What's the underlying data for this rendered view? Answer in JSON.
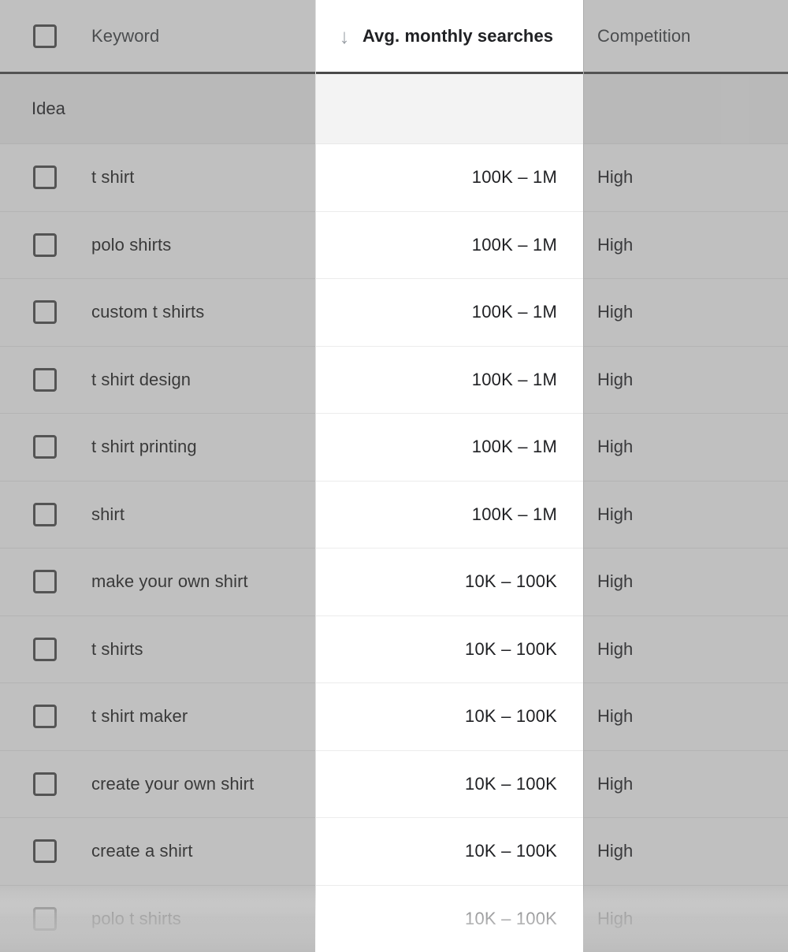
{
  "table": {
    "header": {
      "select_all_checkbox": "select-all",
      "columns": [
        {
          "key": "keyword",
          "label": "Keyword",
          "sorted": false,
          "align": "left"
        },
        {
          "key": "searches",
          "label": "Avg. monthly searches",
          "sorted": true,
          "align": "left",
          "sort_icon": "arrow-down-icon",
          "sort_glyph": "↓",
          "sort_direction": "descending"
        },
        {
          "key": "competition",
          "label": "Competition",
          "sorted": false,
          "align": "left"
        }
      ]
    },
    "group_row": {
      "label": "Idea"
    },
    "rows": [
      {
        "keyword": "t shirt",
        "searches": "100K – 1M",
        "competition": "High"
      },
      {
        "keyword": "polo shirts",
        "searches": "100K – 1M",
        "competition": "High"
      },
      {
        "keyword": "custom t shirts",
        "searches": "100K – 1M",
        "competition": "High"
      },
      {
        "keyword": "t shirt design",
        "searches": "100K – 1M",
        "competition": "High"
      },
      {
        "keyword": "t shirt printing",
        "searches": "100K – 1M",
        "competition": "High"
      },
      {
        "keyword": "shirt",
        "searches": "100K – 1M",
        "competition": "High"
      },
      {
        "keyword": "make your own shirt",
        "searches": "10K – 100K",
        "competition": "High"
      },
      {
        "keyword": "t shirts",
        "searches": "10K – 100K",
        "competition": "High"
      },
      {
        "keyword": "t shirt maker",
        "searches": "10K – 100K",
        "competition": "High"
      },
      {
        "keyword": "create your own shirt",
        "searches": "10K – 100K",
        "competition": "High"
      },
      {
        "keyword": "create a shirt",
        "searches": "10K – 100K",
        "competition": "High"
      },
      {
        "keyword": "polo t shirts",
        "searches": "10K – 100K",
        "competition": "High"
      }
    ]
  },
  "colors": {
    "highlight_column_background": "#ffffff",
    "dimmed_overlay": "#616161",
    "header_rule": "#4a4a4a",
    "row_separator": "#ececec",
    "group_row_background": "#f3f3f3",
    "text_primary": "#202124",
    "text_secondary": "#3c4043",
    "sort_icon": "#9aa0a6",
    "checkbox_border": "#4b4b4b"
  }
}
